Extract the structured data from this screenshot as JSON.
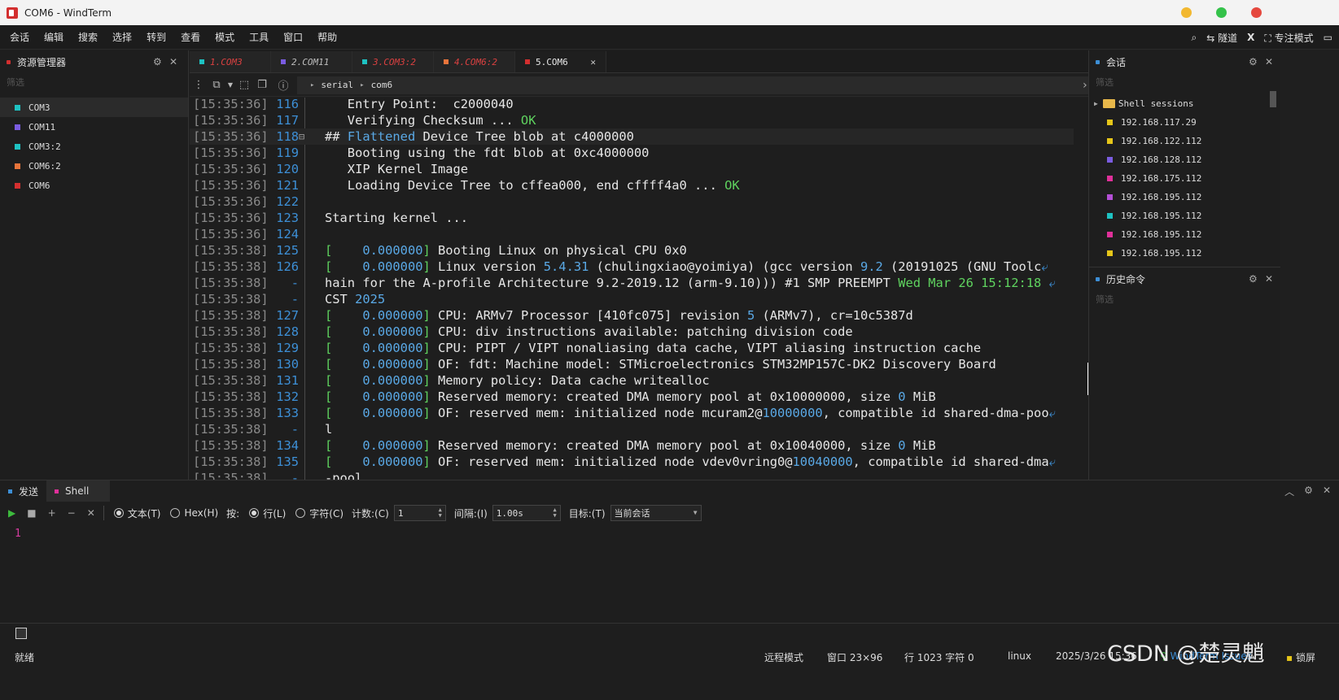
{
  "window": {
    "title": "COM6 - WindTerm"
  },
  "menu": [
    "会话",
    "编辑",
    "搜索",
    "选择",
    "转到",
    "查看",
    "模式",
    "工具",
    "窗口",
    "帮助"
  ],
  "menu_right": {
    "tunnel": "隧道",
    "focus_mode": "专注模式",
    "x_label": "X"
  },
  "explorer": {
    "title": "资源管理器",
    "filter_placeholder": "筛选",
    "items": [
      {
        "label": "COM3",
        "color": "#1ec2c2"
      },
      {
        "label": "COM11",
        "color": "#7a5ce0"
      },
      {
        "label": "COM3:2",
        "color": "#1ec2c2"
      },
      {
        "label": "COM6:2",
        "color": "#e8743b"
      },
      {
        "label": "COM6",
        "color": "#d32f2f"
      }
    ]
  },
  "tabs": [
    {
      "label": "1.COM3",
      "color": "#1ec2c2",
      "text_color": "#d94040"
    },
    {
      "label": "2.COM11",
      "color": "#7a5ce0",
      "text_color": "#bdbdbd"
    },
    {
      "label": "3.COM3:2",
      "color": "#1ec2c2",
      "text_color": "#d94040"
    },
    {
      "label": "4.COM6:2",
      "color": "#e8743b",
      "text_color": "#d94040"
    },
    {
      "label": "5.COM6",
      "color": "#d32f2f",
      "text_color": "#e8e8e8"
    }
  ],
  "tabs_right": {
    "font": "A",
    "add": "+",
    "menu": "≡"
  },
  "breadcrumb": {
    "part1": "serial",
    "part2": "com6"
  },
  "terminal": {
    "lines": [
      {
        "ts": "[15:35:36]",
        "ln": "116",
        "segs": [
          [
            "   Entry Point:  c2000040",
            ""
          ]
        ]
      },
      {
        "ts": "[15:35:36]",
        "ln": "117",
        "segs": [
          [
            "   Verifying Checksum ... ",
            ""
          ],
          [
            "OK",
            "green"
          ]
        ]
      },
      {
        "ts": "[15:35:36]",
        "ln": "118",
        "segs": [
          [
            "## ",
            ""
          ],
          [
            "Flattened",
            "blue"
          ],
          [
            " Device Tree blob at c4000000",
            ""
          ]
        ]
      },
      {
        "ts": "[15:35:36]",
        "ln": "119",
        "segs": [
          [
            "   Booting using the fdt blob at 0xc4000000",
            ""
          ]
        ]
      },
      {
        "ts": "[15:35:36]",
        "ln": "120",
        "segs": [
          [
            "   XIP Kernel Image",
            ""
          ]
        ]
      },
      {
        "ts": "[15:35:36]",
        "ln": "121",
        "segs": [
          [
            "   Loading Device Tree to cffea000, end cffff4a0 ... ",
            ""
          ],
          [
            "OK",
            "green"
          ]
        ]
      },
      {
        "ts": "[15:35:36]",
        "ln": "122",
        "segs": [
          [
            "",
            ""
          ]
        ]
      },
      {
        "ts": "[15:35:36]",
        "ln": "123",
        "segs": [
          [
            "Starting kernel ...",
            ""
          ]
        ]
      },
      {
        "ts": "[15:35:36]",
        "ln": "124",
        "segs": [
          [
            "",
            ""
          ]
        ]
      },
      {
        "ts": "[15:35:38]",
        "ln": "125",
        "segs": [
          [
            "[",
            "green"
          ],
          [
            "    0.000000",
            "blue"
          ],
          [
            "]",
            "green"
          ],
          [
            " Booting Linux on physical CPU 0x0",
            ""
          ]
        ]
      },
      {
        "ts": "[15:35:38]",
        "ln": "126",
        "segs": [
          [
            "[",
            "green"
          ],
          [
            "    0.000000",
            "blue"
          ],
          [
            "]",
            "green"
          ],
          [
            " Linux version ",
            ""
          ],
          [
            "5.4.31",
            "blue"
          ],
          [
            " (chulingxiao@yoimiya) (gcc version ",
            ""
          ],
          [
            "9.2",
            "blue"
          ],
          [
            " (20191025 (GNU Toolc",
            ""
          ],
          [
            "⤶",
            "wrapmark"
          ]
        ]
      },
      {
        "ts": "[15:35:38]",
        "ln": "-",
        "segs": [
          [
            "hain for the A-profile Architecture 9.2-2019.12 (arm-9.10))) #1 SMP PREEMPT ",
            ""
          ],
          [
            "Wed Mar 26 15:12:18",
            "green"
          ],
          [
            " ⤶",
            "wrapmark"
          ]
        ]
      },
      {
        "ts": "[15:35:38]",
        "ln": "-",
        "segs": [
          [
            "CST ",
            ""
          ],
          [
            "2025",
            "blue"
          ]
        ]
      },
      {
        "ts": "[15:35:38]",
        "ln": "127",
        "segs": [
          [
            "[",
            "green"
          ],
          [
            "    0.000000",
            "blue"
          ],
          [
            "]",
            "green"
          ],
          [
            " CPU: ARMv7 Processor [410fc075] revision ",
            ""
          ],
          [
            "5",
            "blue"
          ],
          [
            " (ARMv7), cr=10c5387d",
            ""
          ]
        ]
      },
      {
        "ts": "[15:35:38]",
        "ln": "128",
        "segs": [
          [
            "[",
            "green"
          ],
          [
            "    0.000000",
            "blue"
          ],
          [
            "]",
            "green"
          ],
          [
            " CPU: div instructions available: patching division code",
            ""
          ]
        ]
      },
      {
        "ts": "[15:35:38]",
        "ln": "129",
        "segs": [
          [
            "[",
            "green"
          ],
          [
            "    0.000000",
            "blue"
          ],
          [
            "]",
            "green"
          ],
          [
            " CPU: PIPT / VIPT nonaliasing data cache, VIPT aliasing instruction cache",
            ""
          ]
        ]
      },
      {
        "ts": "[15:35:38]",
        "ln": "130",
        "segs": [
          [
            "[",
            "green"
          ],
          [
            "    0.000000",
            "blue"
          ],
          [
            "]",
            "green"
          ],
          [
            " OF: fdt: Machine model: STMicroelectronics STM32MP157C-DK2 Discovery Board",
            ""
          ]
        ]
      },
      {
        "ts": "[15:35:38]",
        "ln": "131",
        "segs": [
          [
            "[",
            "green"
          ],
          [
            "    0.000000",
            "blue"
          ],
          [
            "]",
            "green"
          ],
          [
            " Memory policy: Data cache writealloc",
            ""
          ]
        ]
      },
      {
        "ts": "[15:35:38]",
        "ln": "132",
        "segs": [
          [
            "[",
            "green"
          ],
          [
            "    0.000000",
            "blue"
          ],
          [
            "]",
            "green"
          ],
          [
            " Reserved memory: created DMA memory pool at 0x10000000, size ",
            ""
          ],
          [
            "0",
            "blue"
          ],
          [
            " MiB",
            ""
          ]
        ]
      },
      {
        "ts": "[15:35:38]",
        "ln": "133",
        "segs": [
          [
            "[",
            "green"
          ],
          [
            "    0.000000",
            "blue"
          ],
          [
            "]",
            "green"
          ],
          [
            " OF: reserved mem: initialized node mcuram2@",
            ""
          ],
          [
            "10000000",
            "blue"
          ],
          [
            ", compatible id shared-dma-poo",
            ""
          ],
          [
            "⤶",
            "wrapmark"
          ]
        ]
      },
      {
        "ts": "[15:35:38]",
        "ln": "-",
        "segs": [
          [
            "l",
            ""
          ]
        ]
      },
      {
        "ts": "[15:35:38]",
        "ln": "134",
        "segs": [
          [
            "[",
            "green"
          ],
          [
            "    0.000000",
            "blue"
          ],
          [
            "]",
            "green"
          ],
          [
            " Reserved memory: created DMA memory pool at 0x10040000, size ",
            ""
          ],
          [
            "0",
            "blue"
          ],
          [
            " MiB",
            ""
          ]
        ]
      },
      {
        "ts": "[15:35:38]",
        "ln": "135",
        "segs": [
          [
            "[",
            "green"
          ],
          [
            "    0.000000",
            "blue"
          ],
          [
            "]",
            "green"
          ],
          [
            " OF: reserved mem: initialized node vdev0vring0@",
            ""
          ],
          [
            "10040000",
            "blue"
          ],
          [
            ", compatible id shared-dma",
            ""
          ],
          [
            "⤶",
            "wrapmark"
          ]
        ]
      },
      {
        "ts": "[15:35:38]",
        "ln": "-",
        "segs": [
          [
            "-pool",
            ""
          ]
        ]
      }
    ]
  },
  "sessions": {
    "title": "会话",
    "filter_placeholder": "筛选",
    "folder": "Shell sessions",
    "items": [
      {
        "label": "192.168.117.29",
        "color": "#e6c619"
      },
      {
        "label": "192.168.122.112",
        "color": "#e6c619"
      },
      {
        "label": "192.168.128.112",
        "color": "#7a5ce0"
      },
      {
        "label": "192.168.175.112",
        "color": "#e0309a"
      },
      {
        "label": "192.168.195.112",
        "color": "#b44fd6"
      },
      {
        "label": "192.168.195.112",
        "color": "#1ec2c2"
      },
      {
        "label": "192.168.195.112",
        "color": "#e0309a"
      },
      {
        "label": "192.168.195.112",
        "color": "#e6c619"
      }
    ]
  },
  "history": {
    "title": "历史命令",
    "filter_placeholder": "筛选"
  },
  "send": {
    "tab_send": "发送",
    "tab_shell": "Shell",
    "text_label": "文本(T)",
    "hex_label": "Hex(H)",
    "by_label": "按:",
    "line_label": "行(L)",
    "char_label": "字符(C)",
    "count_label": "计数:(C)",
    "count_value": "1",
    "interval_label": "间隔:(I)",
    "interval_value": "1.00s",
    "target_label": "目标:(T)",
    "target_value": "当前会话",
    "line_number": "1"
  },
  "status": {
    "ready": "就绪",
    "remote_mode": "远程模式",
    "window_size": "窗口 23×96",
    "cursor": "行 1023 字符 0",
    "os": "linux",
    "datetime": "2025/3/26 15:36",
    "issues": "WindTerm Issues",
    "lock": "锁屏"
  },
  "watermark": "CSDN @楚灵魈"
}
